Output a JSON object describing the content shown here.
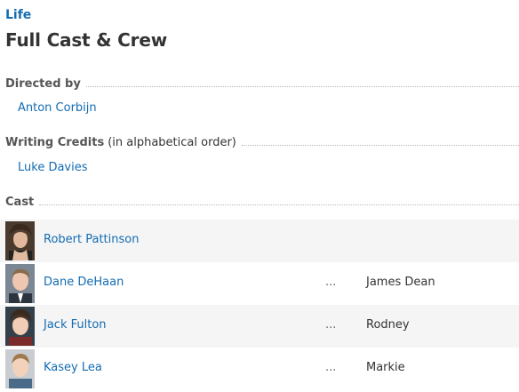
{
  "movie_title": "Life",
  "page_title": "Full Cast & Crew",
  "directed_by": {
    "heading": "Directed by",
    "names": [
      "Anton Corbijn"
    ]
  },
  "writing_credits": {
    "heading": "Writing Credits",
    "subheading": "(in alphabetical order)",
    "names": [
      "Luke Davies"
    ]
  },
  "cast": {
    "heading": "Cast",
    "members": [
      {
        "name": "Robert Pattinson",
        "ellipsis": "",
        "character": ""
      },
      {
        "name": "Dane DeHaan",
        "ellipsis": "...",
        "character": "James Dean"
      },
      {
        "name": "Jack Fulton",
        "ellipsis": "...",
        "character": "Rodney"
      },
      {
        "name": "Kasey Lea",
        "ellipsis": "...",
        "character": "Markie"
      }
    ]
  },
  "colors": {
    "link": "#136cb2",
    "row_alt": "#f5f5f5"
  }
}
